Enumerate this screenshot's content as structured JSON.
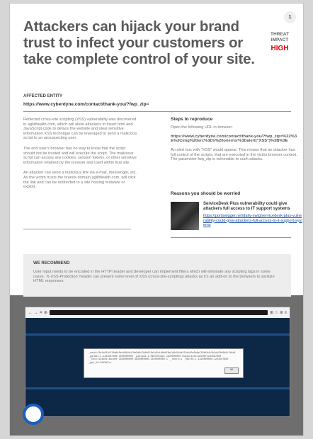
{
  "page_number": "1",
  "headline": "Attackers can hijack your brand trust to infect your customers or take complete control of your site.",
  "threat": {
    "label_line1": "THREAT",
    "label_line2": "IMPACT",
    "level": "HIGH",
    "level_color": "#e10000"
  },
  "affected_entity": {
    "label": "AFFECTED ENTITY",
    "url": "https://www.cyberdyne.com/contact/thank-you/?fwp_zip="
  },
  "description": [
    "Reflected cross-site scripting (XSS) vulnerability was discovered in agilithealth.com, which will allow attackers to insert html and JavaScript code to deface the website and steal sensitive information.XSS technique can be leveraged to send a malicious script to an unsuspecting user.",
    "The end user's browser has no way to know that the script should not be trusted and will execute the script. The malicious script can access any cookies, session tokens, or other sensitive information retained by the browser and used within that site.",
    "An attacker can send a malicious link via e-mail, messenger, etc. As the victim trusts the brands domain agilithealth.com, will click the link and can be redirected to a site hosting malware or exploit."
  ],
  "steps": {
    "title": "Steps to reproduce",
    "intro": "Open the following URL in browser:",
    "url": "https://www.cyberdyne.com/contact/thank-you/?fwp_zip=%22%3E%3Cimg%20src%3Dx%20onerror%3Dalert(\"XSS\")%3B%3E",
    "result": "An alert box with \"XSS\" would appear. This means that an attacker has full control of the scripts, that are executed in the victim browser context. The parameter fwp_zip is vulnerable to such attacks."
  },
  "reasons": {
    "title": "Reasons you should be worried",
    "item_title": "ServiceDesk Plus vulnerability could give attackers full access to IT support systems",
    "item_link": "https://portswigger.net/daily-swig/servicedesk-plus-vulnerability-could-give-attackers-full-access-to-it-support-systems"
  },
  "recommend": {
    "label": "WE RECOMMEND",
    "text": "User input needs to be encoded in the HTTP header and developer can implement filters which will eliminate any scripting tags in some cases. 'X-XSS-Protection' header can prevent some level of XSS (cross-site-scripting) attacks as it's an add-on to the browsers to sanitize HTML responses."
  },
  "screenshot": {
    "nav_icons": "← → ✕ ⊕",
    "right_icons": "⊞ ☆ ⊕ ≡",
    "alert_text": "_sesh=f2e1b0f4d7f8a6c5e4d3b2a1f0e9d8c7b6a5f4e3d2c1b0a9f8e7d6c5b4a3f2e1d0c9b8a7f6e5d4c3b2a1f0e9d8c7b6a5 _ga=GA1.2.1234567890.1620000000 _gid=GA1.2.0987654321.1620000000 hubspotutk=abcdef1234567890 __hstc=123456.abcdef.1620000000.1620000000.1620000000.1 __hssrc=1 _fbp=fb.1.1620000000.1234567890 _gat_UA-XXXXXX=1",
    "alert_button": "OK"
  }
}
